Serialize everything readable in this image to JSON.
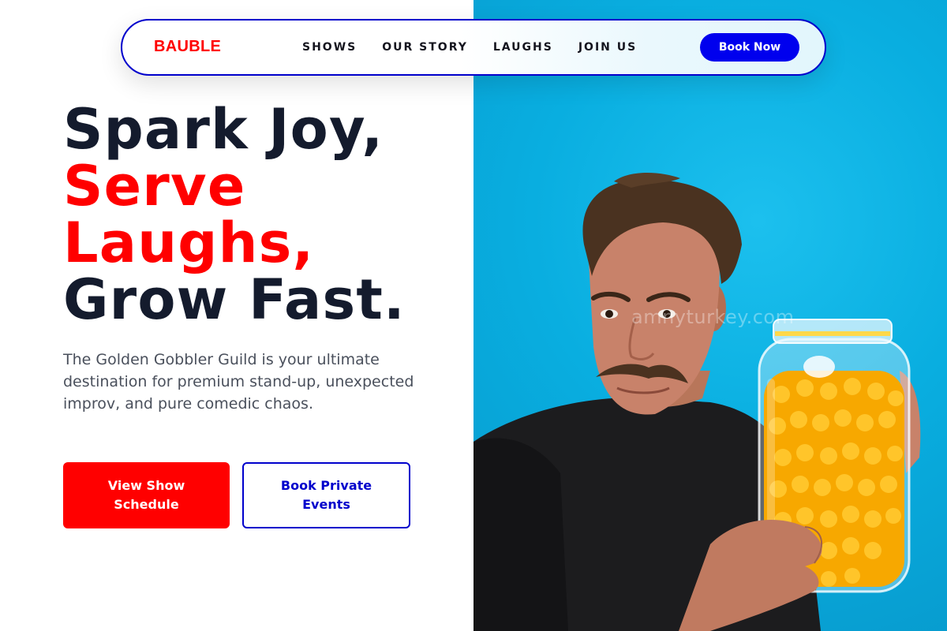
{
  "navbar": {
    "brand": "BAUBLE",
    "links": [
      "SHOWS",
      "OUR STORY",
      "LAUGHS",
      "JOIN US"
    ],
    "cta": "Book Now"
  },
  "hero": {
    "headline": {
      "line1": "Spark Joy,",
      "line2": "Serve",
      "line3": "Laughs,",
      "line4": "Grow Fast."
    },
    "description": "The Golden Gobbler Guild is your ultimate destination for premium stand-up, unexpected improv, and pure comedic chaos.",
    "primary_button": "View Show Schedule",
    "secondary_button": "Book Private Events",
    "image": {
      "watermark": "amnyturkey.com",
      "background_color": "#09aee0"
    }
  },
  "colors": {
    "accent_red": "#ff0000",
    "accent_blue": "#0000ee",
    "heading_dark": "#141b2d",
    "body_gray": "#4a505c"
  }
}
